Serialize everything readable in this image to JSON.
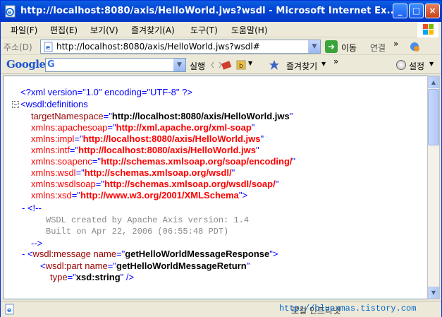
{
  "window": {
    "title": "http://localhost:8080/axis/HelloWorld.jws?wsdl - Microsoft Internet Ex...",
    "minimize_label": "_",
    "maximize_label": "□",
    "close_label": "×"
  },
  "menu": {
    "items": [
      "파일(F)",
      "편집(E)",
      "보기(V)",
      "즐겨찾기(A)",
      "도구(T)",
      "도움말(H)"
    ]
  },
  "address": {
    "label": "주소(D)",
    "value": "http://localhost:8080/axis/HelloWorld.jws?wsdl#",
    "go_label": "이동",
    "links_label": "연결",
    "links_chevron": "»"
  },
  "google_toolbar": {
    "logo": "Google",
    "search_value": "",
    "search_prefix": "G",
    "search_label": "실행",
    "favorites_label": "즐겨찾기",
    "favorites_chevron": "»",
    "settings_label": "설정"
  },
  "xml": {
    "decl": "<?xml version=\"1.0\" encoding=\"UTF-8\" ?>",
    "collapse": "−",
    "def_open": "<wsdl:definitions",
    "attrs": [
      {
        "name": "targetNamespace",
        "value": "http://localhost:8080/axis/HelloWorld.jws"
      },
      {
        "name": "xmlns:apachesoap",
        "value": "http://xml.apache.org/xml-soap"
      },
      {
        "name": "xmlns:impl",
        "value": "http://localhost:8080/axis/HelloWorld.jws"
      },
      {
        "name": "xmlns:intf",
        "value": "http://localhost:8080/axis/HelloWorld.jws"
      },
      {
        "name": "xmlns:soapenc",
        "value": "http://schemas.xmlsoap.org/soap/encoding/"
      },
      {
        "name": "xmlns:wsdl",
        "value": "http://schemas.xmlsoap.org/wsdl/"
      },
      {
        "name": "xmlns:wsdlsoap",
        "value": "http://schemas.xmlsoap.org/wsdl/soap/"
      },
      {
        "name": "xmlns:xsd",
        "value": "http://www.w3.org/2001/XMLSchema"
      }
    ],
    "comment_open": "- <!--",
    "comment_line1": "WSDL created by Apache Axis version: 1.4",
    "comment_line2": "Built on Apr 22, 2006 (06:55:48 PDT)",
    "comment_close": "-->",
    "message_tag": "wsdl:message",
    "message_name_attr": "name",
    "message_name_value": "getHelloWorldMessageResponse",
    "part_tag": "wsdl:part",
    "part_name_value": "getHelloWorldMessageReturn",
    "part_type_attr": "type",
    "part_type_value": "xsd:string"
  },
  "status": {
    "zone_text": "로컬 인트라넷",
    "watermark": "http://bluexmas.tistory.com"
  }
}
